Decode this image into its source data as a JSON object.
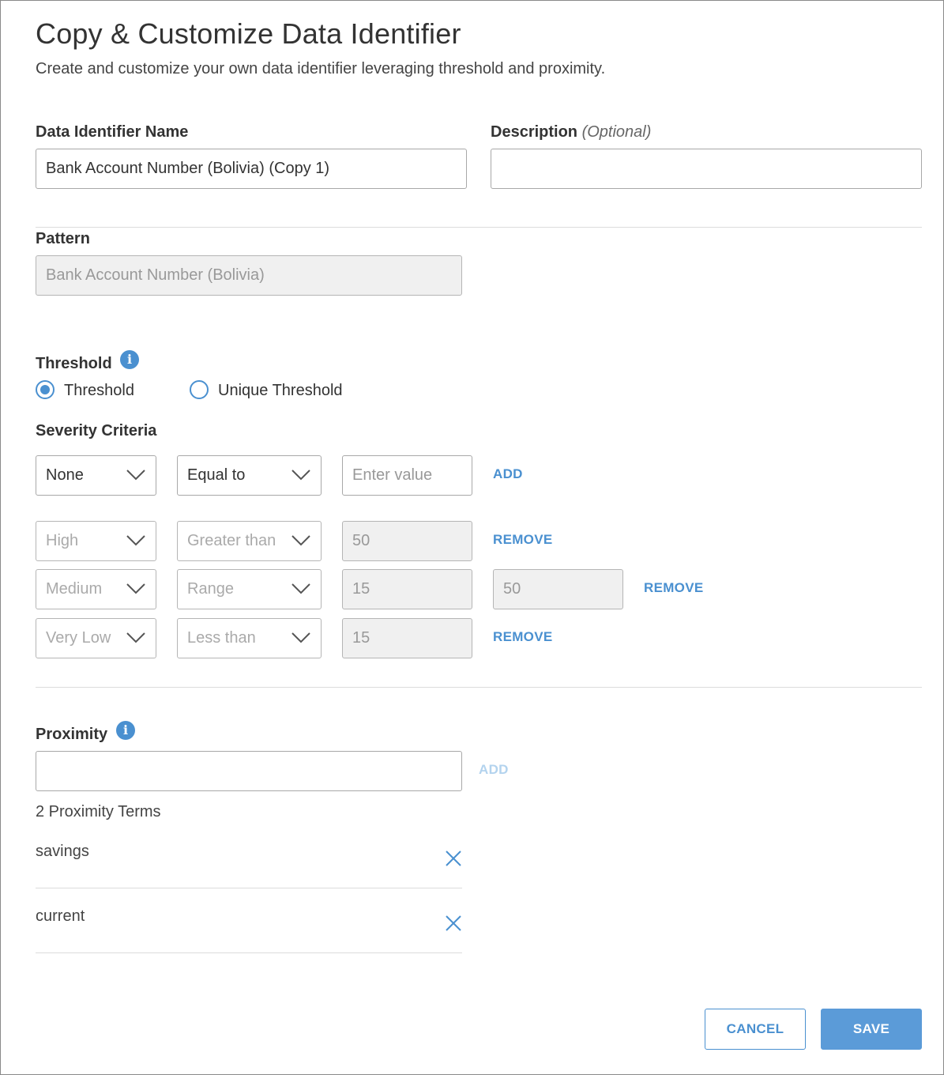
{
  "header": {
    "title": "Copy & Customize Data Identifier",
    "subtitle": "Create and customize your own data identifier leveraging threshold and proximity."
  },
  "name_field": {
    "label": "Data Identifier Name",
    "value": "Bank Account Number (Bolivia) (Copy 1)"
  },
  "description_field": {
    "label": "Description",
    "optional": "(Optional)",
    "value": ""
  },
  "pattern": {
    "label": "Pattern",
    "value": "Bank Account Number (Bolivia)"
  },
  "threshold": {
    "label": "Threshold",
    "info_icon": "info-icon",
    "options": [
      {
        "label": "Threshold",
        "selected": true
      },
      {
        "label": "Unique Threshold",
        "selected": false
      }
    ]
  },
  "severity": {
    "label": "Severity Criteria",
    "new_row": {
      "level": "None",
      "operator": "Equal to",
      "value_placeholder": "Enter value",
      "action": "ADD"
    },
    "rows": [
      {
        "level": "High",
        "operator": "Greater than",
        "value": "50",
        "action": "REMOVE"
      },
      {
        "level": "Medium",
        "operator": "Range",
        "value": "15",
        "value2": "50",
        "action": "REMOVE"
      },
      {
        "level": "Very Low",
        "operator": "Less than",
        "value": "15",
        "action": "REMOVE"
      }
    ]
  },
  "proximity": {
    "label": "Proximity",
    "info_icon": "info-icon",
    "input_value": "",
    "add_label": "ADD",
    "count_text": "2 Proximity Terms",
    "terms": [
      "savings",
      "current"
    ]
  },
  "footer": {
    "cancel_label": "CANCEL",
    "save_label": "SAVE"
  },
  "colors": {
    "accent": "#4a90d0",
    "save_bg": "#5b9bd8",
    "disabled_bg": "#f0f0f0"
  }
}
